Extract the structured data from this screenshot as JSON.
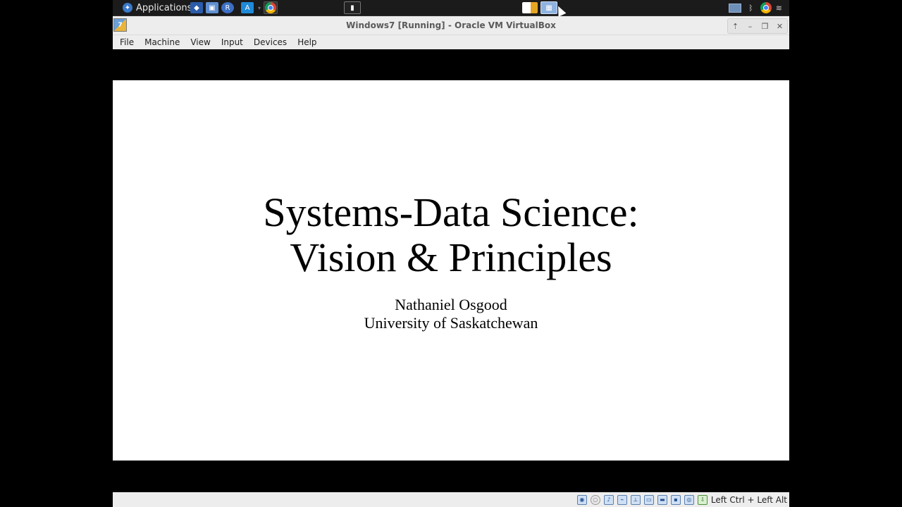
{
  "panel": {
    "applications_label": "Applications",
    "vm_switch_active": true
  },
  "window": {
    "title": "Windows7 [Running] - Oracle VM VirtualBox",
    "icon": "virtualbox-icon",
    "controls": [
      "up-icon",
      "minimize-icon",
      "maximize-icon",
      "close-icon"
    ]
  },
  "menu": {
    "items": [
      "File",
      "Machine",
      "View",
      "Input",
      "Devices",
      "Help"
    ]
  },
  "slide": {
    "title_line1": "Systems-Data Science:",
    "title_line2": "Vision & Principles",
    "author": "Nathaniel Osgood",
    "affiliation": "University of Saskatchewan"
  },
  "statusbar": {
    "icons": [
      "hard-disk-icon",
      "optical-disk-icon",
      "audio-icon",
      "network-icon",
      "usb-icon",
      "shared-folders-icon",
      "display-icon",
      "video-capture-icon",
      "mouse-integration-icon",
      "keyboard-icon"
    ],
    "host_key": "Left Ctrl + Left Alt"
  },
  "colors": {
    "panel_bg": "#1b1b1b",
    "window_chrome": "#ededed",
    "slide_bg": "#ffffff",
    "desktop_bg": "#000000"
  }
}
